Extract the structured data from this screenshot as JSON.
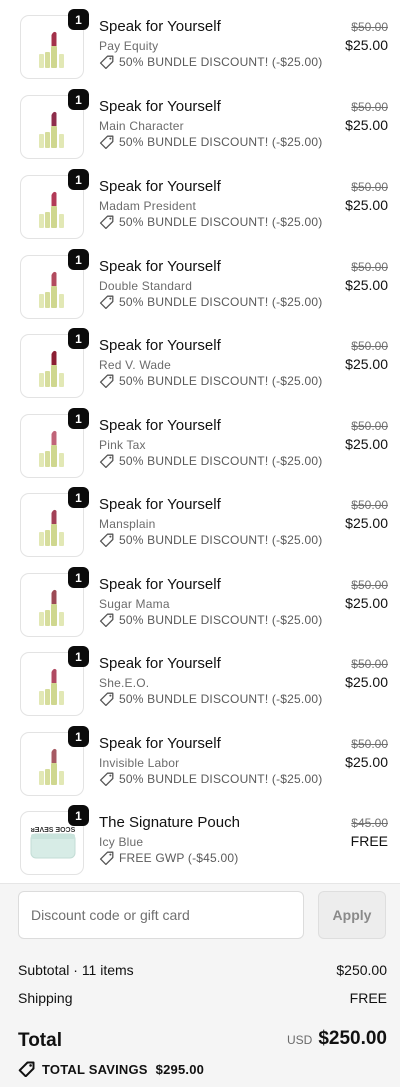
{
  "items": [
    {
      "title": "Speak for Yourself",
      "variant": "Pay Equity",
      "discount": "50% BUNDLE DISCOUNT! (-$25.00)",
      "original_price": "$50.00",
      "price": "$25.00",
      "quantity": "1",
      "image": "lipstick"
    },
    {
      "title": "Speak for Yourself",
      "variant": "Main Character",
      "discount": "50% BUNDLE DISCOUNT! (-$25.00)",
      "original_price": "$50.00",
      "price": "$25.00",
      "quantity": "1",
      "image": "lipstick"
    },
    {
      "title": "Speak for Yourself",
      "variant": "Madam President",
      "discount": "50% BUNDLE DISCOUNT! (-$25.00)",
      "original_price": "$50.00",
      "price": "$25.00",
      "quantity": "1",
      "image": "lipstick"
    },
    {
      "title": "Speak for Yourself",
      "variant": "Double Standard",
      "discount": "50% BUNDLE DISCOUNT! (-$25.00)",
      "original_price": "$50.00",
      "price": "$25.00",
      "quantity": "1",
      "image": "lipstick"
    },
    {
      "title": "Speak for Yourself",
      "variant": "Red V. Wade",
      "discount": "50% BUNDLE DISCOUNT! (-$25.00)",
      "original_price": "$50.00",
      "price": "$25.00",
      "quantity": "1",
      "image": "lipstick"
    },
    {
      "title": "Speak for Yourself",
      "variant": "Pink Tax",
      "discount": "50% BUNDLE DISCOUNT! (-$25.00)",
      "original_price": "$50.00",
      "price": "$25.00",
      "quantity": "1",
      "image": "lipstick"
    },
    {
      "title": "Speak for Yourself",
      "variant": "Mansplain",
      "discount": "50% BUNDLE DISCOUNT! (-$25.00)",
      "original_price": "$50.00",
      "price": "$25.00",
      "quantity": "1",
      "image": "lipstick"
    },
    {
      "title": "Speak for Yourself",
      "variant": "Sugar Mama",
      "discount": "50% BUNDLE DISCOUNT! (-$25.00)",
      "original_price": "$50.00",
      "price": "$25.00",
      "quantity": "1",
      "image": "lipstick"
    },
    {
      "title": "Speak for Yourself",
      "variant": "She.E.O.",
      "discount": "50% BUNDLE DISCOUNT! (-$25.00)",
      "original_price": "$50.00",
      "price": "$25.00",
      "quantity": "1",
      "image": "lipstick"
    },
    {
      "title": "Speak for Yourself",
      "variant": "Invisible Labor",
      "discount": "50% BUNDLE DISCOUNT! (-$25.00)",
      "original_price": "$50.00",
      "price": "$25.00",
      "quantity": "1",
      "image": "lipstick"
    },
    {
      "title": "The Signature Pouch",
      "variant": "Icy Blue",
      "discount": "FREE GWP (-$45.00)",
      "original_price": "$45.00",
      "price": "FREE",
      "quantity": "1",
      "image": "pouch"
    }
  ],
  "lipstick_colors": [
    "#a3314a",
    "#8e2d4b",
    "#b23a57",
    "#b24b5e",
    "#8c1f33",
    "#c06478",
    "#a24157",
    "#9c4a55",
    "#b04a62",
    "#a65a63"
  ],
  "pouch_text": "ᴚƎΛƎS ƎOϽS",
  "discount_field": {
    "placeholder": "Discount code or gift card",
    "value": ""
  },
  "apply_label": "Apply",
  "subtotal": {
    "label": "Subtotal · 11 items",
    "value": "$250.00"
  },
  "shipping": {
    "label": "Shipping",
    "value": "FREE"
  },
  "total": {
    "label": "Total",
    "currency": "USD",
    "value": "$250.00"
  },
  "savings": {
    "label": "TOTAL SAVINGS",
    "value": "$295.00"
  },
  "colors": {
    "accent_text": "#111111",
    "muted_text": "#6b6b6b",
    "summary_bg": "#f5f5f5",
    "badge_bg": "#0b0b0b",
    "pouch": "#d7ece6",
    "lipstick_case": "#e2e8b5"
  }
}
